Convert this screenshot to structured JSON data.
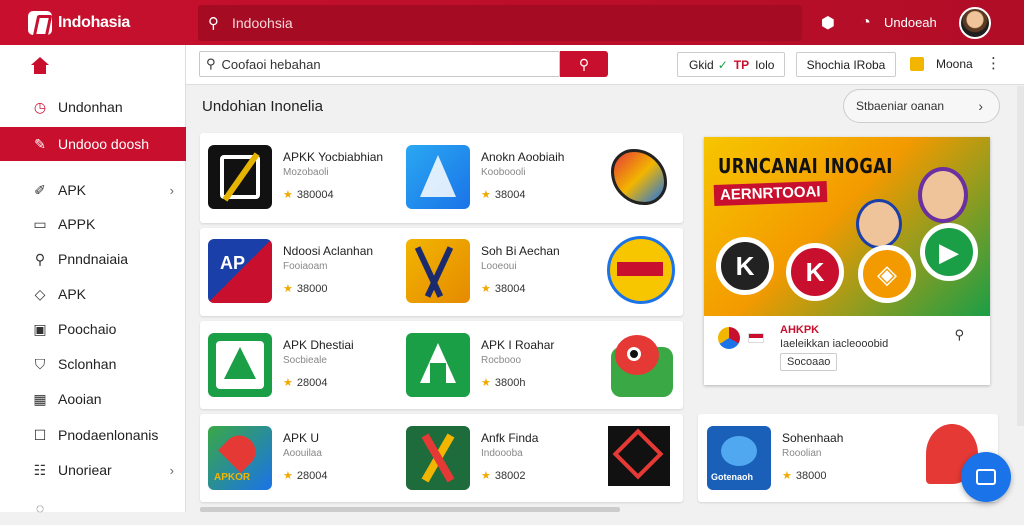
{
  "topbar": {
    "logo_text": "Indohasia",
    "search_placeholder": "Indoohsia",
    "user_label": "Undoeah"
  },
  "sidebar": {
    "items": [
      {
        "label": "Undonhan",
        "icon": "clock-icon",
        "chevron": false
      },
      {
        "label": "Undooo doosh",
        "icon": "edit-square-icon",
        "chevron": false,
        "active": true
      },
      {
        "label": "APK",
        "icon": "pencil-icon",
        "chevron": true
      },
      {
        "label": "APPK",
        "icon": "window-icon",
        "chevron": false
      },
      {
        "label": "Pnndnaiaia",
        "icon": "pin-icon",
        "chevron": false
      },
      {
        "label": "APK",
        "icon": "tag-icon",
        "chevron": false
      },
      {
        "label": "Poochaio",
        "icon": "image-icon",
        "chevron": false
      },
      {
        "label": "Sclonhan",
        "icon": "shield-icon",
        "chevron": false
      },
      {
        "label": "Aooian",
        "icon": "grid-icon",
        "chevron": false
      },
      {
        "label": "Pnodaenlonanis",
        "icon": "box-icon",
        "chevron": false
      },
      {
        "label": "Unoriear",
        "icon": "list-icon",
        "chevron": true
      }
    ]
  },
  "toolbar": {
    "search_placeholder": "Coofaoi hebahan",
    "filter_1_a": "Gkid",
    "filter_1_b": "TP",
    "filter_1_c": "Iolo",
    "filter_2": "Shochia IRoba",
    "filter_3": "Moona"
  },
  "section": {
    "title": "Undohian Inonelia",
    "pill_label": "Stbaeniar oanan"
  },
  "apps": [
    {
      "name": "APKK Yocbiabhian",
      "sub": "Mozobaoli",
      "count": "380004"
    },
    {
      "name": "Anokn Aoobiaih",
      "sub": "Kooboooli",
      "count": "38004"
    },
    {
      "name": "Ndoosi Aclanhan",
      "sub": "Fooiaoam",
      "count": "38000"
    },
    {
      "name": "Soh Bi Aechan",
      "sub": "Looeoui",
      "count": "38004"
    },
    {
      "name": "APK Dhestiai",
      "sub": "Socbieale",
      "count": "28004"
    },
    {
      "name": "APK I Roahar",
      "sub": "Rocbooo",
      "count": "3800h"
    },
    {
      "name": "APK U",
      "sub": "Aoouilaa",
      "count": "28004"
    },
    {
      "name": "Anfk Finda",
      "sub": "Indoooba",
      "count": "38002"
    },
    {
      "name": "Sohenhaah",
      "sub": "Rooolian",
      "count": "38000"
    }
  ],
  "banner": {
    "title": "URNCANAI INOGAI",
    "subtitle": "AERNRTOOAI",
    "circle_1": "K",
    "circle_2": "K",
    "info_title": "AHKPK",
    "info_desc": "Iaeleikkan iacleooobid",
    "info_tag": "Socoaao"
  },
  "colors": {
    "brand_red": "#c8102e",
    "accent_blue": "#1a73e8",
    "green": "#1a9e46",
    "yellow": "#f2b500"
  }
}
